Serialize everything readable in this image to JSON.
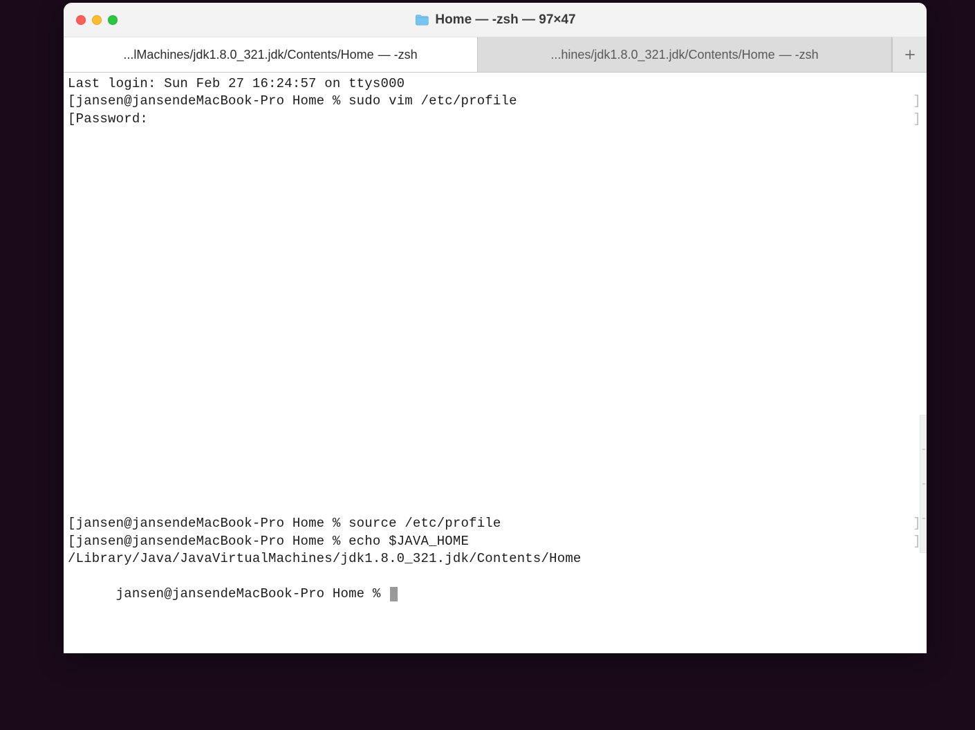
{
  "window": {
    "title": "Home — -zsh — 97×47",
    "folder_icon": "folder-icon"
  },
  "tabs": [
    {
      "path": "...lMachines/jdk1.8.0_321.jdk/Contents/Home",
      "shell": "— -zsh",
      "active": true
    },
    {
      "path": "...hines/jdk1.8.0_321.jdk/Contents/Home",
      "shell": "— -zsh",
      "active": false
    }
  ],
  "terminal": {
    "last_login": "Last login: Sun Feb 27 16:24:57 on ttys000",
    "prompt_open": "[",
    "prompt_close": "]",
    "lines_top": [
      {
        "prompt": "jansen@jansendeMacBook-Pro Home % ",
        "cmd": "sudo vim /etc/profile",
        "bracketed": true
      },
      {
        "prompt": "Password:",
        "cmd": "",
        "bracketed": true
      }
    ],
    "lines_bottom": [
      {
        "prompt": "jansen@jansendeMacBook-Pro Home % ",
        "cmd": "source /etc/profile",
        "bracketed": true
      },
      {
        "prompt": "jansen@jansendeMacBook-Pro Home % ",
        "cmd": "echo $JAVA_HOME",
        "bracketed": true
      }
    ],
    "output": "/Library/Java/JavaVirtualMachines/jdk1.8.0_321.jdk/Contents/Home",
    "final_prompt": "jansen@jansendeMacBook-Pro Home % "
  }
}
